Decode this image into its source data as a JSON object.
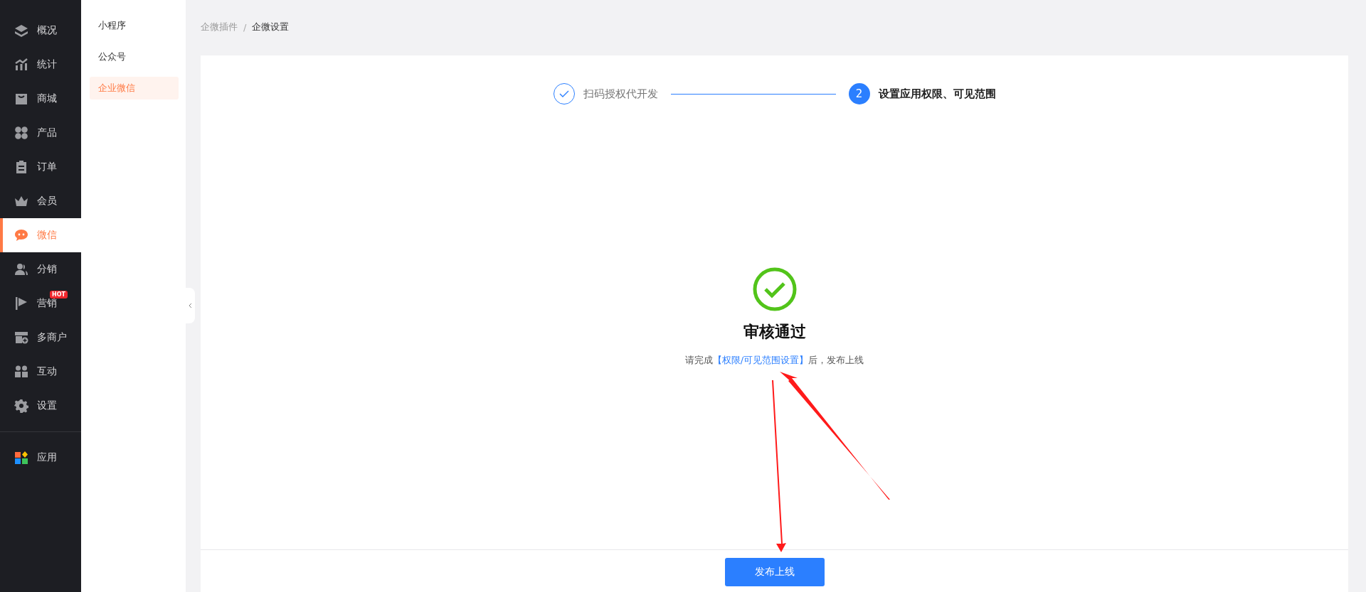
{
  "sidebar": {
    "items": [
      {
        "label": "概况",
        "selected": false
      },
      {
        "label": "统计",
        "selected": false
      },
      {
        "label": "商城",
        "selected": false
      },
      {
        "label": "产品",
        "selected": false
      },
      {
        "label": "订单",
        "selected": false
      },
      {
        "label": "会员",
        "selected": false
      },
      {
        "label": "微信",
        "selected": true
      },
      {
        "label": "分销",
        "selected": false
      },
      {
        "label": "营销",
        "selected": false,
        "badge": "HOT"
      },
      {
        "label": "多商户",
        "selected": false
      },
      {
        "label": "互动",
        "selected": false
      },
      {
        "label": "设置",
        "selected": false
      }
    ],
    "bottom_items": [
      {
        "label": "应用",
        "selected": false
      }
    ]
  },
  "submenu": {
    "items": [
      {
        "label": "小程序",
        "selected": false
      },
      {
        "label": "公众号",
        "selected": false
      },
      {
        "label": "企业微信",
        "selected": true
      }
    ]
  },
  "breadcrumb": {
    "items": [
      "企微插件",
      "企微设置"
    ],
    "separator": "/"
  },
  "steps": [
    {
      "label": "扫码授权代开发",
      "completed": true
    },
    {
      "number": "2",
      "label": "设置应用权限、可见范围",
      "completed": false
    }
  ],
  "result": {
    "title": "审核通过",
    "message_before": "请完成",
    "link": "【权限/可见范围设置】",
    "message_after": "后，发布上线"
  },
  "button": "发布上线",
  "annotations": [
    {
      "kind": "arrow"
    },
    {
      "kind": "arrow"
    }
  ]
}
